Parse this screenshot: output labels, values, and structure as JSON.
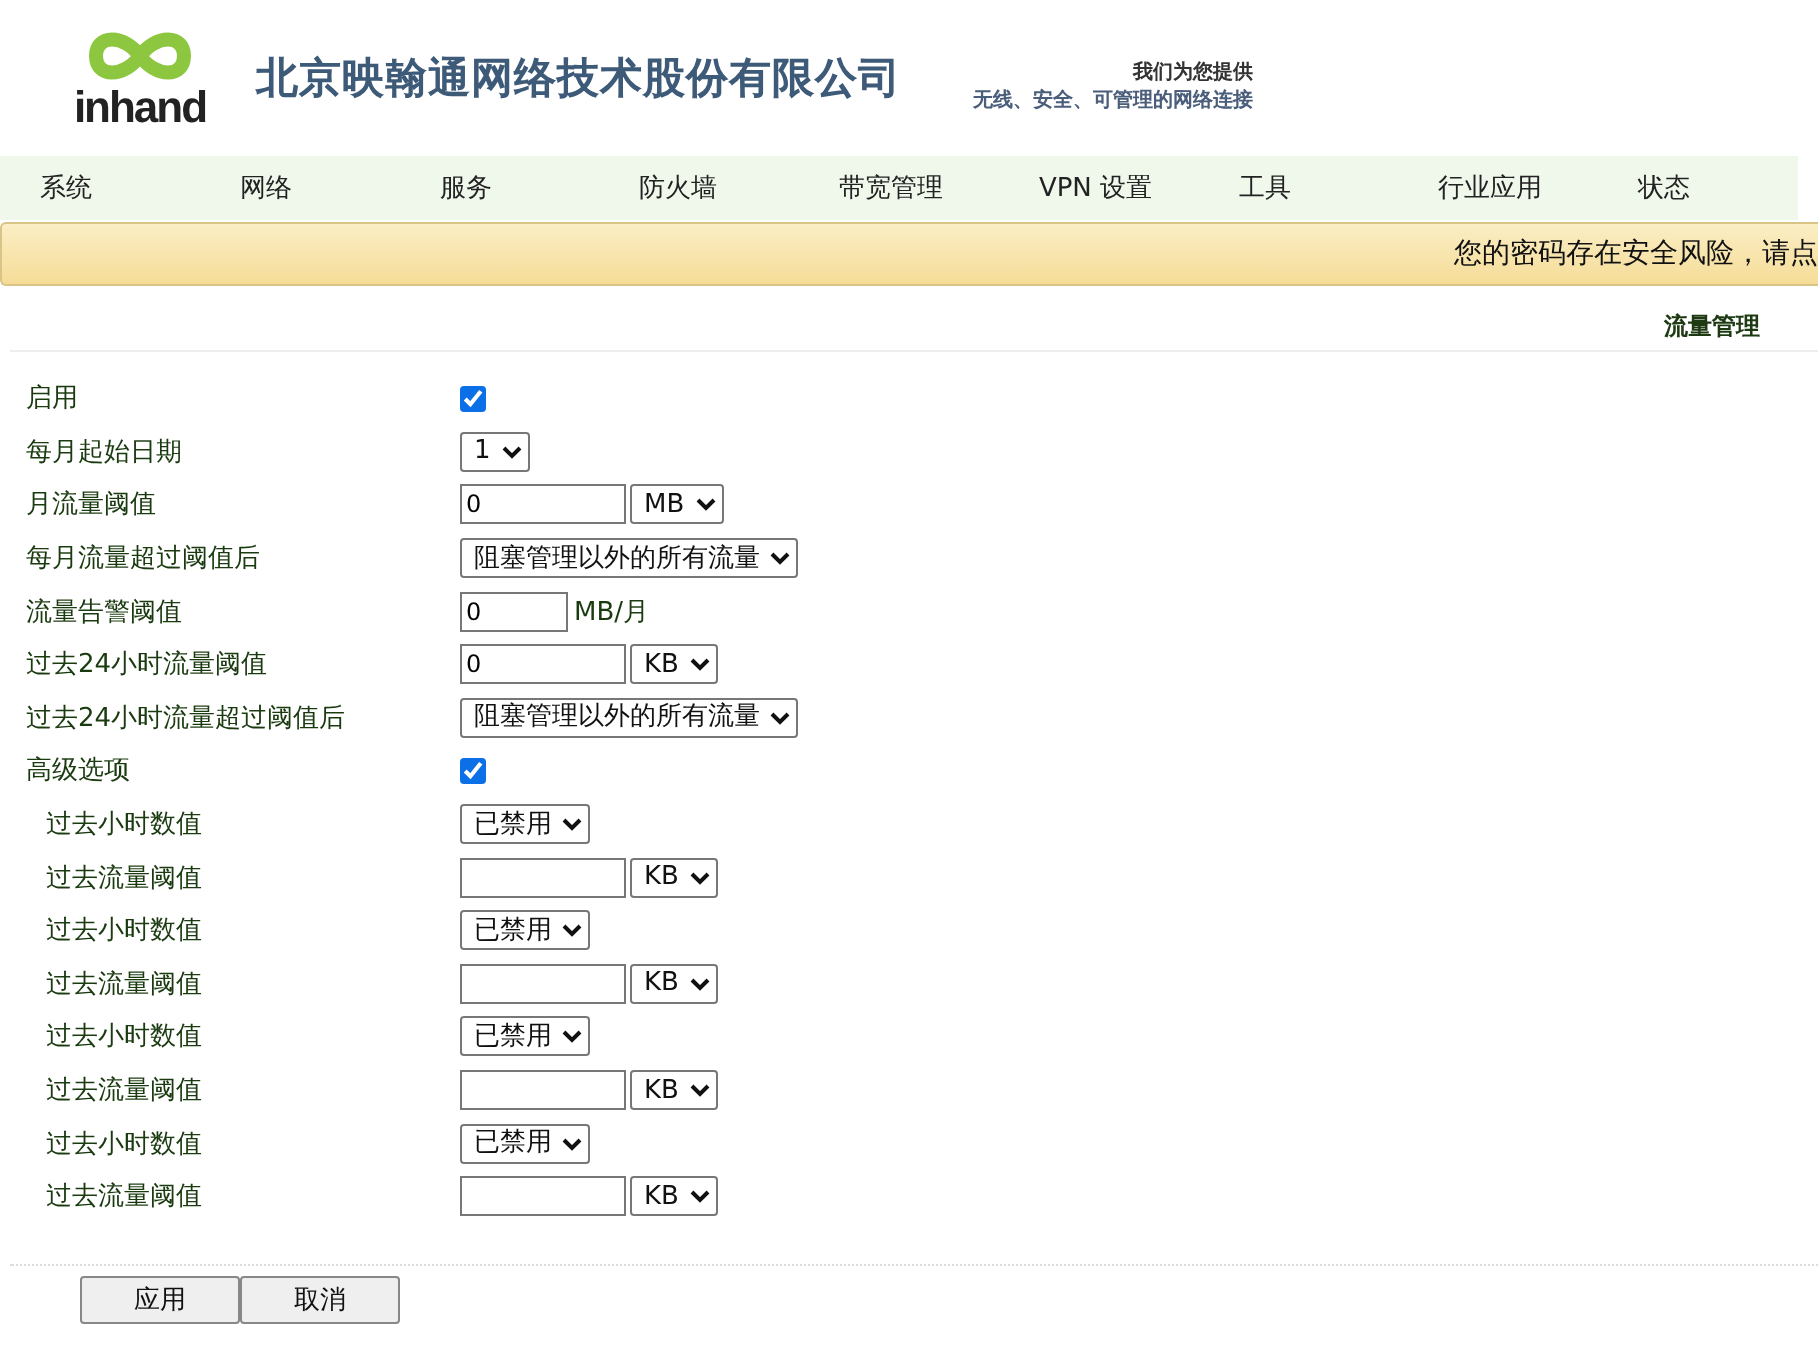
{
  "header": {
    "logo_text": "inhand",
    "company": "北京映翰通网络技术股份有限公司",
    "tagline": [
      "我们为您提供",
      "无线、安全、可管理的网络连接"
    ]
  },
  "nav": [
    {
      "label": "系统"
    },
    {
      "label": "网络"
    },
    {
      "label": "服务"
    },
    {
      "label": "防火墙"
    },
    {
      "label": "带宽管理"
    },
    {
      "label": "VPN 设置"
    },
    {
      "label": "工具"
    },
    {
      "label": "行业应用"
    },
    {
      "label": "状态"
    }
  ],
  "banner": "您的密码存在安全风险，请点",
  "page_title": "流量管理",
  "rows": [
    {
      "kind": "checkbox",
      "label": "启用",
      "checked": true
    },
    {
      "kind": "select",
      "label": "每月起始日期",
      "value": "1"
    },
    {
      "kind": "input_select",
      "label": "月流量阈值",
      "value": "0",
      "unit": "MB"
    },
    {
      "kind": "select",
      "label": "每月流量超过阈值后",
      "value": "阻塞管理以外的所有流量"
    },
    {
      "kind": "input_unit",
      "label": "流量告警阈值",
      "value": "0",
      "unit": "MB/月"
    },
    {
      "kind": "input_select",
      "label": "过去24小时流量阈值",
      "value": "0",
      "unit": "KB"
    },
    {
      "kind": "select",
      "label": "过去24小时流量超过阈值后",
      "value": "阻塞管理以外的所有流量"
    },
    {
      "kind": "checkbox",
      "label": "高级选项",
      "checked": true,
      "children": [
        {
          "kind": "select",
          "label": "过去小时数值",
          "value": "已禁用"
        },
        {
          "kind": "input_select",
          "label": "过去流量阈值",
          "unit": "KB"
        },
        {
          "kind": "select",
          "label": "过去小时数值",
          "value": "已禁用"
        },
        {
          "kind": "input_select",
          "label": "过去流量阈值",
          "unit": "KB"
        },
        {
          "kind": "select",
          "label": "过去小时数值",
          "value": "已禁用"
        },
        {
          "kind": "input_select",
          "label": "过去流量阈值",
          "unit": "KB"
        },
        {
          "kind": "select",
          "label": "过去小时数值",
          "value": "已禁用"
        },
        {
          "kind": "input_select",
          "label": "过去流量阈值",
          "unit": "KB"
        }
      ]
    }
  ],
  "buttons": [
    "应用",
    "取消"
  ]
}
